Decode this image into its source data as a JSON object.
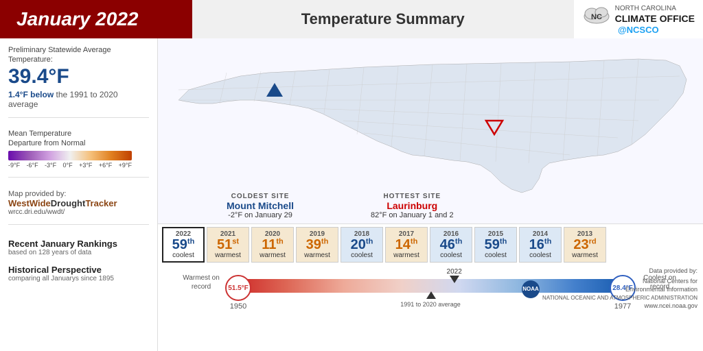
{
  "header": {
    "title": "January 2022",
    "subtitle": "Temperature Summary",
    "nc_office_line1": "NORTH CAROLINA",
    "nc_office_line2": "CLIMATE OFFICE",
    "twitter": "@NCSCO"
  },
  "avg_temp": {
    "label": "Preliminary Statewide\nAverage Temperature:",
    "value": "39.4°F",
    "below_text": "1.4°F below",
    "below_suffix": " the 1991 to 2020 average"
  },
  "legend": {
    "title": "Mean Temperature\nDeparture from Normal",
    "labels": [
      "-9°F",
      "-6°F",
      "-3°F",
      "0°F",
      "+3°F",
      "+6°F",
      "+9°F"
    ]
  },
  "map_credit": {
    "prefix": "Map provided by:",
    "name_part1": "WestWide",
    "name_part2": "Drought",
    "name_part3": "Tracker",
    "url": "wrcc.dri.edu/wwdt/"
  },
  "coldest_site": {
    "label": "COLDEST SITE",
    "name": "Mount Mitchell",
    "temp": "-2°F on January 29"
  },
  "hottest_site": {
    "label": "HOTTEST SITE",
    "name": "Laurinburg",
    "temp": "82°F on January 1 and 2"
  },
  "rankings": {
    "title": "Recent January Rankings",
    "subtitle": "based on 128 years of data",
    "years": [
      {
        "year": "2022",
        "rank": "59",
        "suffix": "th",
        "label": "coolest",
        "type": "coolest",
        "current": true
      },
      {
        "year": "2021",
        "rank": "51",
        "suffix": "st",
        "label": "warmest",
        "type": "warmest"
      },
      {
        "year": "2020",
        "rank": "11",
        "suffix": "th",
        "label": "warmest",
        "type": "warmest"
      },
      {
        "year": "2019",
        "rank": "39",
        "suffix": "th",
        "label": "warmest",
        "type": "warmest"
      },
      {
        "year": "2018",
        "rank": "20",
        "suffix": "th",
        "label": "coolest",
        "type": "coolest"
      },
      {
        "year": "2017",
        "rank": "14",
        "suffix": "th",
        "label": "warmest",
        "type": "warmest"
      },
      {
        "year": "2016",
        "rank": "46",
        "suffix": "th",
        "label": "coolest",
        "type": "coolest"
      },
      {
        "year": "2015",
        "rank": "59",
        "suffix": "th",
        "label": "coolest",
        "type": "coolest"
      },
      {
        "year": "2014",
        "rank": "16",
        "suffix": "th",
        "label": "coolest",
        "type": "coolest"
      },
      {
        "year": "2013",
        "rank": "23",
        "suffix": "rd",
        "label": "warmest",
        "type": "warmest"
      }
    ]
  },
  "historical": {
    "title": "Historical Perspective",
    "subtitle": "comparing all Januarys since 1895",
    "warmest_label": "Warmest\non record",
    "warmest_temp": "51.5°F",
    "warmest_year": "1950",
    "coolest_label": "Coolest\non record",
    "coolest_temp": "28.4°F",
    "coolest_year": "1977",
    "avg_label": "1991 to 2020 average",
    "current_year": "2022"
  },
  "data_provider": {
    "label": "Data provided by:",
    "org_line1": "National Centers for",
    "org_line2": "Environmental Information",
    "org_line3": "NATIONAL OCEANIC AND ATMOSPHERIC ADMINISTRATION",
    "url": "www.ncei.noaa.gov"
  }
}
